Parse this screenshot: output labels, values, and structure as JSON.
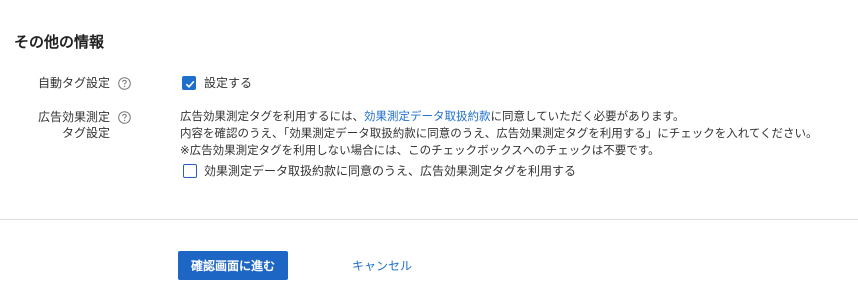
{
  "section": {
    "title": "その他の情報"
  },
  "auto_tag": {
    "label": "自動タグ設定",
    "checkbox_label": "設定する",
    "checked": true
  },
  "ad_tag": {
    "label": "広告効果測定タグ設定",
    "desc_line1_before": "広告効果測定タグを利用するには、",
    "desc_line1_link": "効果測定データ取扱約款",
    "desc_line1_after": "に同意していただく必要があります。",
    "desc_line2": "内容を確認のうえ、「効果測定データ取扱約款に同意のうえ、広告効果測定タグを利用する」にチェックを入れてください。",
    "desc_line3": "※広告効果測定タグを利用しない場合には、このチェックボックスへのチェックは不要です。",
    "checkbox_label": "効果測定データ取扱約款に同意のうえ、広告効果測定タグを利用する",
    "checked": false
  },
  "actions": {
    "submit_label": "確認画面に進む",
    "cancel_label": "キャンセル"
  },
  "colors": {
    "accent": "#1f6fcc",
    "primary_button": "#1d66c4",
    "divider": "#dcdcdc"
  }
}
